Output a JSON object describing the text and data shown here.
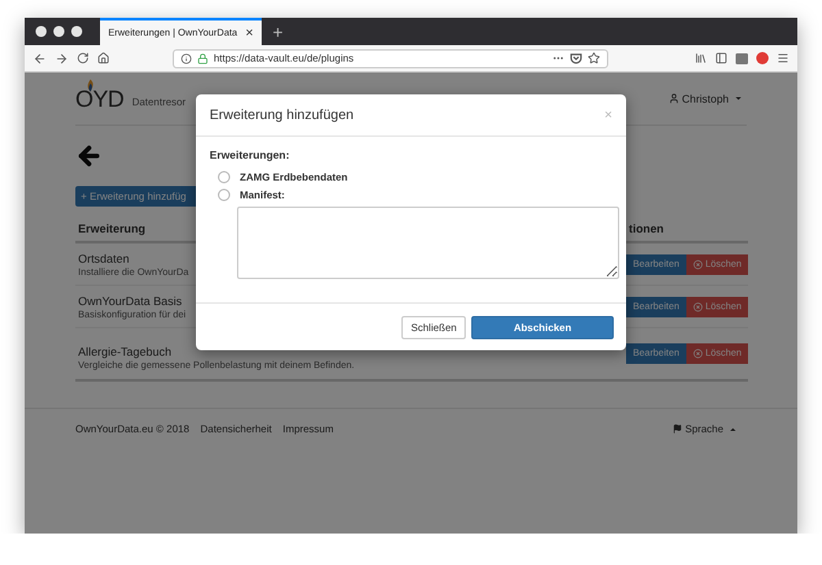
{
  "browser": {
    "tab_title": "Erweiterungen | OwnYourData",
    "tab_close": "×",
    "new_tab": "+",
    "url": "https://data-vault.eu/de/plugins"
  },
  "navbar": {
    "brand": "OYD",
    "subtitle": "Datentresor",
    "user": "Christoph"
  },
  "add_button": "+ Erweiterung hinzufüg",
  "table": {
    "columns": [
      "Erweiterung",
      "tionen"
    ],
    "rows": [
      {
        "name": "Ortsdaten",
        "description": "Installiere die OwnYourDa",
        "actions": [
          "Bearbeiten",
          "Löschen"
        ]
      },
      {
        "name": "OwnYourData Basis",
        "description": "Basiskonfiguration für dei",
        "actions": [
          "Bearbeiten",
          "Löschen"
        ]
      },
      {
        "name": "Allergie-Tagebuch",
        "description": "Vergleiche die gemessene Pollenbelastung mit deinem Befinden.",
        "actions": [
          "Bearbeiten",
          "Löschen"
        ]
      }
    ]
  },
  "footer": {
    "links": [
      "OwnYourData.eu © 2018",
      "Datensicherheit",
      "Impressum"
    ],
    "language": "Sprache"
  },
  "modal": {
    "title": "Erweiterung hinzufügen",
    "close": "×",
    "label": "Erweiterungen:",
    "options": [
      {
        "label": "ZAMG Erdbebendaten",
        "selected": false
      },
      {
        "label": "Manifest:",
        "selected": false
      }
    ],
    "buttons": [
      {
        "label": "Schließen",
        "kind": "default"
      },
      {
        "label": "Abschicken",
        "kind": "primary"
      }
    ]
  }
}
